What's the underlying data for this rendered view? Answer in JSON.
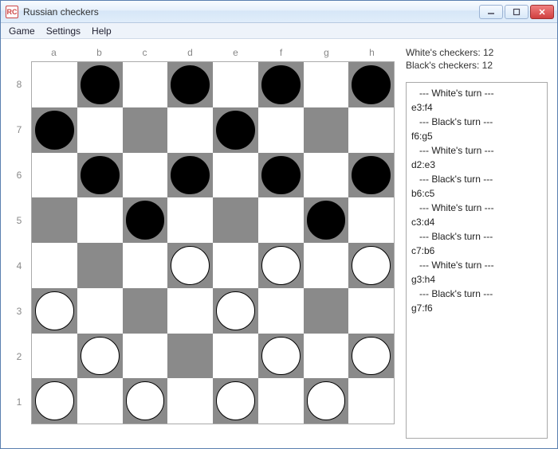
{
  "window": {
    "title": "Russian checkers",
    "icon_label": "RC"
  },
  "menu": {
    "game": "Game",
    "settings": "Settings",
    "help": "Help"
  },
  "board": {
    "cols": [
      "a",
      "b",
      "c",
      "d",
      "e",
      "f",
      "g",
      "h"
    ],
    "rows": [
      "8",
      "7",
      "6",
      "5",
      "4",
      "3",
      "2",
      "1"
    ],
    "pieces": [
      {
        "col": "b",
        "row": "8",
        "color": "black"
      },
      {
        "col": "d",
        "row": "8",
        "color": "black"
      },
      {
        "col": "f",
        "row": "8",
        "color": "black"
      },
      {
        "col": "h",
        "row": "8",
        "color": "black"
      },
      {
        "col": "a",
        "row": "7",
        "color": "black"
      },
      {
        "col": "e",
        "row": "7",
        "color": "black"
      },
      {
        "col": "b",
        "row": "6",
        "color": "black"
      },
      {
        "col": "d",
        "row": "6",
        "color": "black"
      },
      {
        "col": "f",
        "row": "6",
        "color": "black"
      },
      {
        "col": "h",
        "row": "6",
        "color": "black"
      },
      {
        "col": "c",
        "row": "5",
        "color": "black"
      },
      {
        "col": "g",
        "row": "5",
        "color": "black"
      },
      {
        "col": "d",
        "row": "4",
        "color": "white"
      },
      {
        "col": "f",
        "row": "4",
        "color": "white"
      },
      {
        "col": "h",
        "row": "4",
        "color": "white"
      },
      {
        "col": "a",
        "row": "3",
        "color": "white"
      },
      {
        "col": "e",
        "row": "3",
        "color": "white"
      },
      {
        "col": "b",
        "row": "2",
        "color": "white"
      },
      {
        "col": "f",
        "row": "2",
        "color": "white"
      },
      {
        "col": "h",
        "row": "2",
        "color": "white"
      },
      {
        "col": "a",
        "row": "1",
        "color": "white"
      },
      {
        "col": "c",
        "row": "1",
        "color": "white"
      },
      {
        "col": "e",
        "row": "1",
        "color": "white"
      },
      {
        "col": "g",
        "row": "1",
        "color": "white"
      }
    ]
  },
  "stats": {
    "whites_label": "White's checkers: 12",
    "blacks_label": "Black's checkers: 12"
  },
  "moves": [
    {
      "turn": "  --- White's turn ---",
      "move": "e3:f4"
    },
    {
      "turn": "  --- Black's turn ---",
      "move": "f6:g5"
    },
    {
      "turn": "  --- White's turn ---",
      "move": "d2:e3"
    },
    {
      "turn": "  --- Black's turn ---",
      "move": "b6:c5"
    },
    {
      "turn": "  --- White's turn ---",
      "move": "c3:d4"
    },
    {
      "turn": "  --- Black's turn ---",
      "move": "c7:b6"
    },
    {
      "turn": "  --- White's turn ---",
      "move": "g3:h4"
    },
    {
      "turn": "  --- Black's turn ---",
      "move": "g7:f6"
    }
  ]
}
